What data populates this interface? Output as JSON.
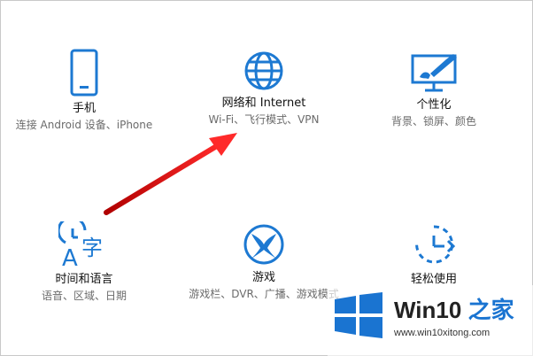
{
  "colors": {
    "accent": "#1d79d2",
    "arrow": "#e02020",
    "logo": "#1a74d1"
  },
  "tiles": [
    {
      "icon": "phone-icon",
      "title": "手机",
      "desc": "连接 Android 设备、iPhone"
    },
    {
      "icon": "globe-icon",
      "title": "网络和 Internet",
      "desc": "Wi-Fi、飞行模式、VPN"
    },
    {
      "icon": "personalization-icon",
      "title": "个性化",
      "desc": "背景、锁屏、颜色"
    },
    {
      "icon": "time-language-icon",
      "title": "时间和语言",
      "desc": "语音、区域、日期"
    },
    {
      "icon": "xbox-icon",
      "title": "游戏",
      "desc": "游戏栏、DVR、广播、游戏模式"
    },
    {
      "icon": "ease-of-access-icon",
      "title": "轻松使用",
      "desc": ""
    }
  ],
  "watermark": {
    "brand": "Win10",
    "brand_suffix": "之家",
    "url": "www.win10xitong.com"
  }
}
